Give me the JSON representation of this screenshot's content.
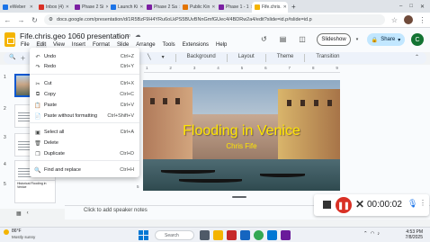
{
  "browser": {
    "tabs": [
      {
        "label": "eWeber",
        "color": "#1a73e8"
      },
      {
        "label": "Inbox (4)",
        "color": "#d93025"
      },
      {
        "label": "Phase 2 Si",
        "color": "#7b1fa2"
      },
      {
        "label": "Launch Ki",
        "color": "#1a73e8"
      },
      {
        "label": "Phase 2 Sa",
        "color": "#7b1fa2"
      },
      {
        "label": "Public Kin",
        "color": "#e37400"
      },
      {
        "label": "Phase 1 - 1",
        "color": "#7b1fa2"
      },
      {
        "label": "Fife.chris.",
        "color": "#f4b400"
      }
    ],
    "url": "docs.google.com/presentation/d/1R5BzF9H4YRu6oLkPS5BUvBNnGmfGUec4/4BDRw2a4/edit?slide=id.p#slide=id.p"
  },
  "doc": {
    "title": "Fife.chris.geo 1060 presentation",
    "menus": [
      "File",
      "Edit",
      "View",
      "Insert",
      "Format",
      "Slide",
      "Arrange",
      "Tools",
      "Extensions",
      "Help"
    ],
    "open_menu": "Edit",
    "slideshow_label": "Slideshow",
    "share_label": "Share",
    "user_initial": "C"
  },
  "toolbar": {
    "items": [
      "Background",
      "Layout",
      "Theme",
      "Transition"
    ]
  },
  "edit_menu": [
    {
      "label": "Undo",
      "shortcut": "Ctrl+Z",
      "icon": "undo-icon",
      "glyph": "↶",
      "disabled": false
    },
    {
      "label": "Redo",
      "shortcut": "Ctrl+Y",
      "icon": "redo-icon",
      "glyph": "↷",
      "disabled": false
    },
    {
      "label": "Cut",
      "shortcut": "Ctrl+X",
      "icon": "cut-icon",
      "glyph": "✂",
      "disabled": false
    },
    {
      "label": "Copy",
      "shortcut": "Ctrl+C",
      "icon": "copy-icon",
      "glyph": "⧉",
      "disabled": false
    },
    {
      "label": "Paste",
      "shortcut": "Ctrl+V",
      "icon": "paste-icon",
      "glyph": "📋",
      "disabled": false
    },
    {
      "label": "Paste without formatting",
      "shortcut": "Ctrl+Shift+V",
      "icon": "paste-plain-icon",
      "glyph": "📄",
      "disabled": false
    },
    {
      "label": "Select all",
      "shortcut": "Ctrl+A",
      "icon": "select-all-icon",
      "glyph": "▣",
      "disabled": false
    },
    {
      "label": "Delete",
      "shortcut": "",
      "icon": "delete-icon",
      "glyph": "🗑",
      "disabled": false
    },
    {
      "label": "Duplicate",
      "shortcut": "Ctrl+D",
      "icon": "duplicate-icon",
      "glyph": "❐",
      "disabled": false
    },
    {
      "label": "Find and replace",
      "shortcut": "Ctrl+H",
      "icon": "find-replace-icon",
      "glyph": "🔍",
      "disabled": false
    }
  ],
  "filmstrip": {
    "slides": [
      {
        "num": "1",
        "title": ""
      },
      {
        "num": "2",
        "title": ""
      },
      {
        "num": "3",
        "title": ""
      },
      {
        "num": "4",
        "title": ""
      },
      {
        "num": "5",
        "title": "Historical Flooding in Venice"
      }
    ]
  },
  "slide": {
    "title": "Flooding in Venice",
    "subtitle": "Chris Fife"
  },
  "ruler": {
    "top": [
      "1",
      "2",
      "3",
      "4",
      "5",
      "6",
      "7",
      "8",
      "9"
    ],
    "left": [
      "1",
      "2",
      "3",
      "4",
      "5"
    ]
  },
  "speaker_notes_placeholder": "Click to add speaker notes",
  "recorder": {
    "time": "00:00:02"
  },
  "taskbar": {
    "temp": "86°F",
    "weather_desc": "Mostly sunny",
    "search_label": "Search",
    "time": "4:53 PM",
    "date": "7/8/2025"
  }
}
